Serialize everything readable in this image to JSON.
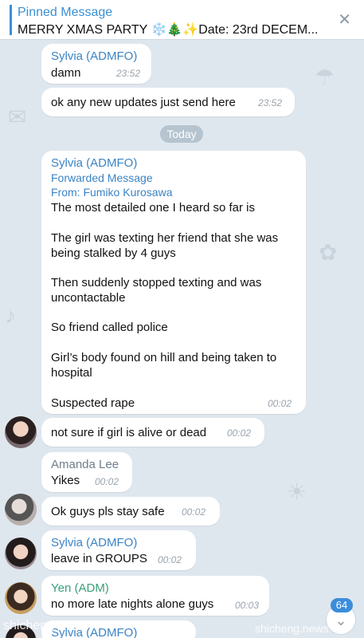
{
  "pinned": {
    "title": "Pinned Message",
    "text": "MERRY XMAS PARTY ❄️🎄✨Date: 23rd DECEM...",
    "close_icon": "✕"
  },
  "date_separator": "Today",
  "messages": [
    {
      "sender": "Sylvia (ADMFO)",
      "text": "damn",
      "time": "23:52"
    },
    {
      "text": "ok any new updates just send here",
      "time": "23:52"
    },
    {
      "sender": "Sylvia (ADMFO)",
      "forwarded_label": "Forwarded Message",
      "forwarded_from": "From: Fumiko Kurosawa",
      "paragraphs": [
        "The most detailed one I heard so far is",
        "The girl was texting her friend that she was being stalked  by 4 guys",
        "Then suddenly stopped texting and was uncontactable",
        "So friend called police",
        "Girl’s body found on hill and being taken to hospital",
        "Suspected rape"
      ],
      "time": "00:02"
    },
    {
      "text": "not sure if girl is alive or dead",
      "time": "00:02"
    },
    {
      "sender": "Amanda Lee",
      "text": "Yikes",
      "time": "00:02"
    },
    {
      "text": "Ok guys pls stay safe",
      "time": "00:02"
    },
    {
      "sender": "Sylvia (ADMFO)",
      "text": "leave in GROUPS",
      "time": "00:02"
    },
    {
      "sender": "Yen (ADM)",
      "text": "no more late nights alone guys",
      "time": "00:03"
    },
    {
      "sender": "Sylvia (ADMFO)"
    }
  ],
  "unread_badge": "64",
  "scroll_icon": "⌄",
  "watermark_left": "shicheng",
  "watermark_right": "shicheng.news"
}
